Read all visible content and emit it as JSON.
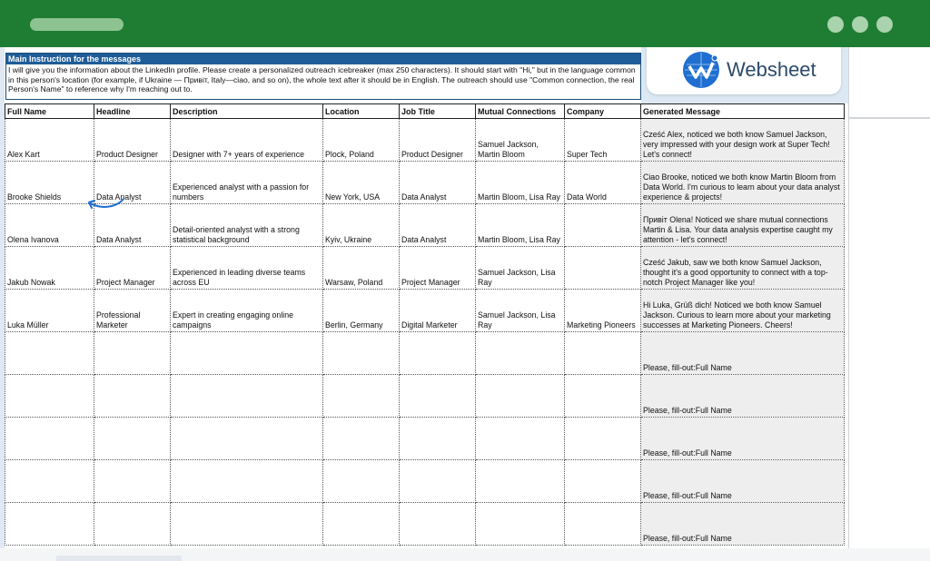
{
  "instruction": {
    "title": "Main Instruction for the messages",
    "text": "I will give you the information about the LinkedIn profile. Please create a personalized outreach icebreaker (max 250 characters). It should start with \"Hi,\" but in the language common in this person's location (for example, if Ukraine — Привіт, Italy—ciao, and so on), the whole text after it should be in English. The outreach should use \"Common connection, the real Person's Name\" to reference why I'm reaching out to."
  },
  "logo": {
    "text": "Websheet",
    "icon": "websheet-logo-icon"
  },
  "table": {
    "columns": [
      "Full Name",
      "Headline",
      "Description",
      "Location",
      "Job Title",
      "Mutual Connections",
      "Company",
      "Generated Message"
    ],
    "rows": [
      [
        "Alex Kart",
        "Product Designer",
        "Designer with 7+ years of experience",
        "Plock, Poland",
        "Product Designer",
        "Samuel Jackson, Martin Bloom",
        "Super Tech",
        "Cześć Alex, noticed we both know Samuel Jackson, very impressed with your design work at Super Tech! Let's connect!"
      ],
      [
        "Brooke Shields",
        "Data Analyst",
        "Experienced analyst with a passion for numbers",
        "New York, USA",
        "Data Analyst",
        "Martin Bloom, Lisa Ray",
        "Data World",
        "Ciao Brooke, noticed we both know Martin Bloom from Data World. I'm curious to learn about your data analyst experience & projects!"
      ],
      [
        "Olena Ivanova",
        "Data Analyst",
        "Detail-oriented analyst with a strong statistical background",
        "Kyiv, Ukraine",
        "Data Analyst",
        "Martin Bloom, Lisa Ray",
        "",
        "Привіт Olena! Noticed we share mutual connections Martin & Lisa. Your data analysis expertise caught my attention - let's connect!"
      ],
      [
        "Jakub Nowak",
        "Project Manager",
        "Experienced in leading diverse teams across EU",
        "Warsaw, Poland",
        "Project Manager",
        "Samuel Jackson, Lisa Ray",
        "",
        "Cześć Jakub, saw we both know Samuel Jackson, thought it's a good opportunity to connect with a top-notch Project Manager like you!"
      ],
      [
        "Luka Müller",
        "Professional Marketer",
        "Expert in creating engaging online campaigns",
        "Berlin, Germany",
        "Digital Marketer",
        "Samuel Jackson, Lisa Ray",
        "Marketing Pioneers",
        "Hi Luka, Grüß dich! Noticed we both know Samuel Jackson. Curious to learn more about your marketing successes at Marketing Pioneers. Cheers!"
      ],
      [
        "",
        "",
        "",
        "",
        "",
        "",
        "",
        "Please, fill-out:Full Name"
      ],
      [
        "",
        "",
        "",
        "",
        "",
        "",
        "",
        "Please, fill-out:Full Name"
      ],
      [
        "",
        "",
        "",
        "",
        "",
        "",
        "",
        "Please, fill-out:Full Name"
      ],
      [
        "",
        "",
        "",
        "",
        "",
        "",
        "",
        "Please, fill-out:Full Name"
      ],
      [
        "",
        "",
        "",
        "",
        "",
        "",
        "",
        "Please, fill-out:Full Name"
      ]
    ]
  },
  "colors": {
    "chrome": "#1e7d32",
    "header_blue": "#1f5d99",
    "generated_bg": "#eeeeee"
  }
}
